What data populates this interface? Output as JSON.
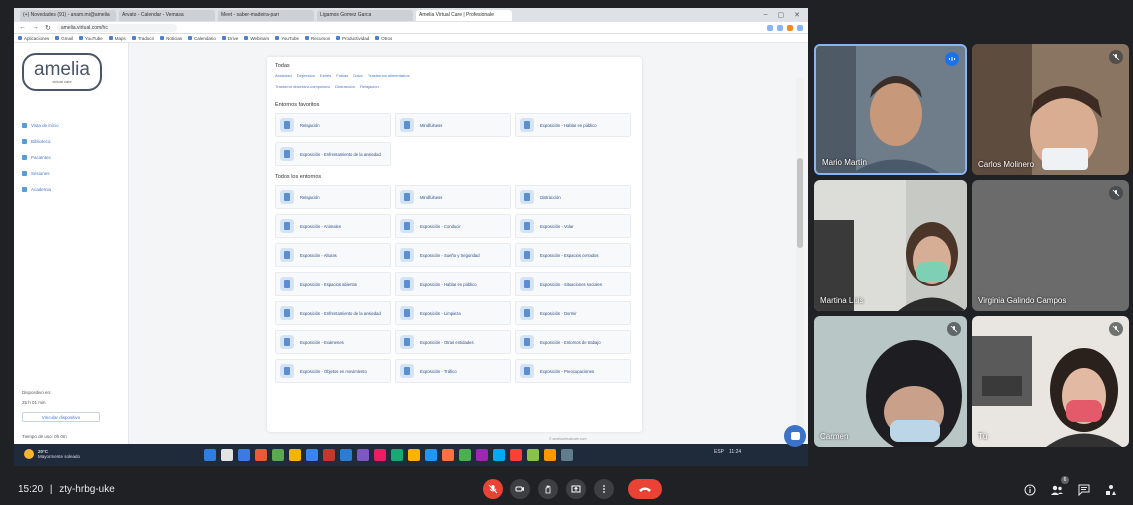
{
  "browser": {
    "tabs": [
      "(+) Novedades (91) - anam.mi@amelia",
      "Arvato - Calendar - Vemasa",
      "Meet - saber-madeira-parr",
      "Ligamos Gomez Garca",
      "Amelia Virtual Care | Profesionale"
    ],
    "url": "amelia.virtual.com/hc",
    "bookmarks": [
      "Aplicaciones",
      "Gmail",
      "YouTube",
      "Maps",
      "Traducir",
      "Noticias",
      "Calendario",
      "Drive",
      "Webinars",
      "YouTube",
      "Recursos",
      "Productividad",
      "Otros"
    ]
  },
  "app": {
    "logo_main": "amelia",
    "logo_sub": "virtual care",
    "nav": [
      "Vista de inicio",
      "Biblioteca",
      "Pacientes",
      "Sesiones",
      "Academia"
    ],
    "device_label": "Dispositivo en:",
    "device_row": "25 h 01 min",
    "device_button": "Vincular dispositivo",
    "footer_left": "Tiempo de uso: 0h 0m",
    "app_footer": "© ameliavirtualcare.com",
    "section_tags": "Todas",
    "tags_row1": [
      "Ansiedad",
      "Depresión",
      "Estrés",
      "Fobias",
      "Dolor",
      "Trastornos alimentarios"
    ],
    "tags_row2": [
      "Trastorno obsesivo-compulsivo",
      "Distracción",
      "Relajación"
    ],
    "section_fav": "Entornos favoritos",
    "favorites": [
      "Relajación",
      "Mindfulness",
      "Exposición - Hablar en público",
      "Exposición - Enfrentamiento de la ansiedad"
    ],
    "section_all": "Todos los entornos",
    "environments": [
      "Relajación",
      "Mindfulness",
      "Distracción",
      "Exposición - Animales",
      "Exposición - Conducir",
      "Exposición - Volar",
      "Exposición - Alturas",
      "Exposición - Sueño y Seguridad",
      "Exposición - Espacios cerrados",
      "Exposición - Espacios abiertos",
      "Exposición - Hablar en público",
      "Exposición - Situaciones sociales",
      "Exposición - Enfrentamiento de la ansiedad",
      "Exposición - Limpieza",
      "Exposición - Dormir",
      "Exposición - Exámenes",
      "Exposición - Otras entidades",
      "Exposición - Entornos de trabajo",
      "Exposición - Objetos en movimiento",
      "Exposición - Tráfico",
      "Exposición - Preocupaciones"
    ]
  },
  "taskbar": {
    "weather_temp": "20°C",
    "weather_desc": "Mayormente soleado",
    "tray": [
      "ESP",
      "11:24"
    ]
  },
  "participants": [
    {
      "name": "Mario Martín",
      "speaking": true
    },
    {
      "name": "Carlos Molinero",
      "speaking": false
    },
    {
      "name": "Martina Luis",
      "speaking": false
    },
    {
      "name": "Virginia Galindo Campos",
      "speaking": false
    },
    {
      "name": "Carmen",
      "speaking": false
    },
    {
      "name": "Tú",
      "speaking": false
    }
  ],
  "meeting": {
    "time": "15:20",
    "separator": "|",
    "code": "zty-hrbg-uke"
  },
  "colors": {
    "meet_bg": "#202124",
    "hangup": "#ea4335",
    "accent": "#1a73e8",
    "app_accent": "#4a77c4"
  },
  "icons": [
    "mic-off-icon",
    "camera-icon",
    "raise-hand-icon",
    "present-icon",
    "more-options-icon",
    "hangup-icon",
    "info-icon",
    "people-icon",
    "chat-icon",
    "activities-icon"
  ],
  "people_count": "6"
}
